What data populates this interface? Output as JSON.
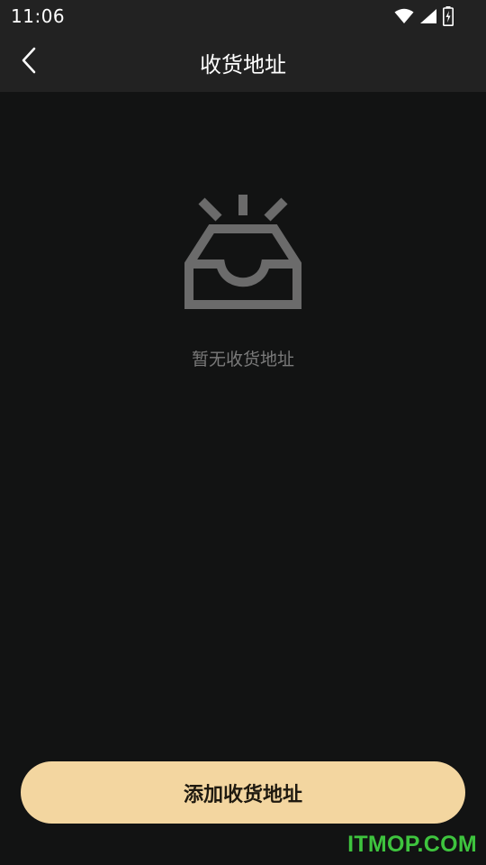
{
  "status_bar": {
    "time": "11:06",
    "icons": [
      "wifi-icon",
      "cellular-signal-icon",
      "battery-charging-icon"
    ]
  },
  "app_bar": {
    "back_icon": "chevron-left-icon",
    "title": "收货地址"
  },
  "empty_state": {
    "icon": "empty-inbox-icon",
    "message": "暂无收货地址"
  },
  "actions": {
    "add_address_label": "添加收货地址"
  },
  "watermark": {
    "text": "ITMOP.COM"
  },
  "colors": {
    "background": "#121313",
    "bar": "#222222",
    "accent_button": "#f3d6a0",
    "muted_text": "#7a7a7a",
    "icon_gray": "#6b6b6b",
    "watermark": "#3ec43e"
  }
}
